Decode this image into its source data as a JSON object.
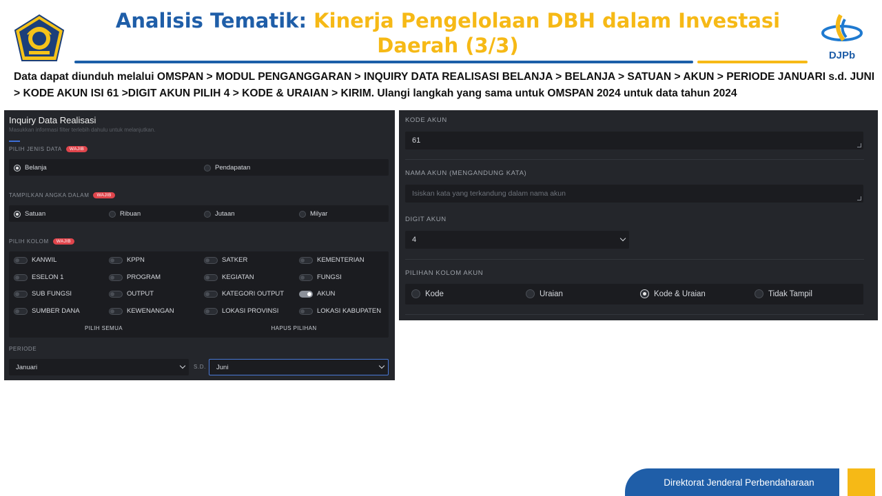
{
  "header": {
    "title_prefix": "Analisis Tematik:",
    "title_main": "Kinerja Pengelolaan DBH dalam Investasi Daerah (3/3)",
    "logo_right_text": "DJPb",
    "colors": {
      "blue": "#1f5ea8",
      "yellow": "#f6b916"
    }
  },
  "instruction": "Data dapat diunduh melalui OMSPAN > MODUL PENGANGGARAN > INQUIRY DATA REALISASI BELANJA > BELANJA > SATUAN > AKUN > PERIODE JANUARI s.d. JUNI > KODE AKUN ISI 61 >DIGIT AKUN PILIH 4 > KODE & URAIAN > KIRIM. Ulangi langkah yang sama untuk OMSPAN 2024 untuk data tahun 2024",
  "left_panel": {
    "title": "Inquiry Data Realisasi",
    "subtitle": "Masukkan informasi filter terlebih dahulu untuk melanjutkan.",
    "badge": "WAJIB",
    "jenis_data": {
      "label": "PILIH JENIS DATA",
      "options": [
        "Belanja",
        "Pendapatan"
      ],
      "selected": "Belanja"
    },
    "angka": {
      "label": "TAMPILKAN ANGKA DALAM",
      "options": [
        "Satuan",
        "Ribuan",
        "Jutaan",
        "Milyar"
      ],
      "selected": "Satuan"
    },
    "kolom": {
      "label": "PILIH KOLOM",
      "items": [
        [
          "KANWIL",
          "KPPN",
          "SATKER",
          "KEMENTERIAN"
        ],
        [
          "ESELON 1",
          "PROGRAM",
          "KEGIATAN",
          "FUNGSI"
        ],
        [
          "SUB FUNGSI",
          "OUTPUT",
          "KATEGORI OUTPUT",
          "AKUN"
        ],
        [
          "SUMBER DANA",
          "KEWENANGAN",
          "LOKASI PROVINSI",
          "LOKASI KABUPATEN"
        ]
      ],
      "enabled": "AKUN",
      "select_all": "PILIH SEMUA",
      "clear": "HAPUS PILIHAN"
    },
    "periode": {
      "label": "PERIODE",
      "from": "Januari",
      "separator": "S.D.",
      "to": "Juni"
    }
  },
  "right_panel": {
    "kode_akun": {
      "label": "KODE AKUN",
      "value": "61"
    },
    "nama_akun": {
      "label": "NAMA AKUN (MENGANDUNG KATA)",
      "placeholder": "Isiskan kata yang terkandung dalam nama akun"
    },
    "digit_akun": {
      "label": "DIGIT AKUN",
      "value": "4"
    },
    "kolom_akun": {
      "label": "PILIHAN KOLOM AKUN",
      "options": [
        "Kode",
        "Uraian",
        "Kode & Uraian",
        "Tidak Tampil"
      ],
      "selected": "Kode & Uraian"
    }
  },
  "footer": {
    "text": "Direktorat Jenderal Perbendaharaan"
  }
}
